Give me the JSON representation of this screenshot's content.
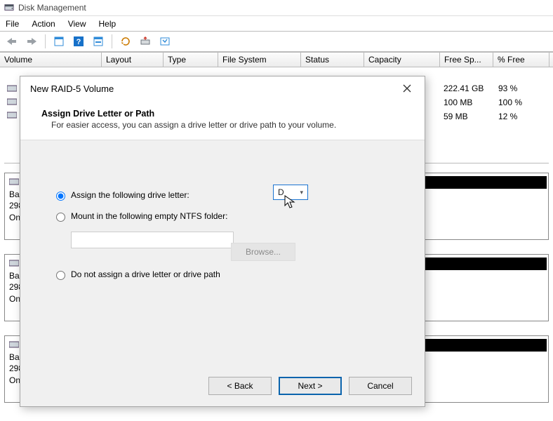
{
  "app": {
    "title": "Disk Management"
  },
  "menu": {
    "file": "File",
    "action": "Action",
    "view": "View",
    "help": "Help"
  },
  "columns": [
    "Volume",
    "Layout",
    "Type",
    "File System",
    "Status",
    "Capacity",
    "Free Sp...",
    "% Free"
  ],
  "rows": [
    {
      "free": "222.41 GB",
      "pct": "93 %"
    },
    {
      "free": "100 MB",
      "pct": "100 %"
    },
    {
      "free": "59 MB",
      "pct": "12 %"
    }
  ],
  "disks": [
    {
      "label_lines": [
        "Bas",
        "298",
        "On"
      ]
    },
    {
      "label_lines": [
        "Bas",
        "298",
        "On"
      ]
    },
    {
      "label_lines": [
        "Bas",
        "298",
        "On"
      ]
    }
  ],
  "dialog": {
    "title": "New RAID-5 Volume",
    "heading": "Assign Drive Letter or Path",
    "subheading": "For easier access, you can assign a drive letter or drive path to your volume.",
    "options": {
      "assign": "Assign the following drive letter:",
      "mount": "Mount in the following empty NTFS folder:",
      "none": "Do not assign a drive letter or drive path"
    },
    "selected_letter": "D",
    "browse": "Browse...",
    "buttons": {
      "back": "< Back",
      "next": "Next >",
      "cancel": "Cancel"
    },
    "selected_option": "assign"
  }
}
